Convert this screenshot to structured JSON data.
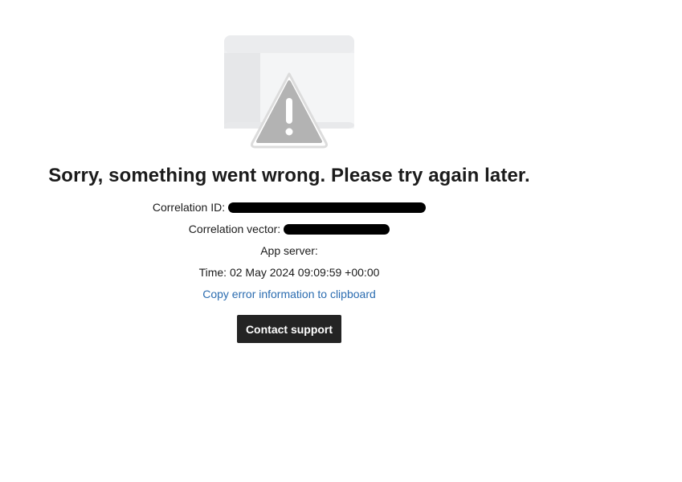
{
  "error": {
    "title": "Sorry, something went wrong. Please try again later.",
    "correlation_id_label": "Correlation ID:",
    "correlation_vector_label": "Correlation vector:",
    "app_server_label": "App server:",
    "time_text": "Time: 02 May 2024 09:09:59 +00:00",
    "copy_link_label": "Copy error information to clipboard",
    "contact_button_label": "Contact support"
  },
  "icons": {
    "illustration": "window-warning-icon",
    "warning": "warning-triangle-icon"
  },
  "colors": {
    "link": "#2b6cb0",
    "button_bg": "#242424",
    "button_text": "#ffffff",
    "warning_fill": "#b3b3b3"
  }
}
